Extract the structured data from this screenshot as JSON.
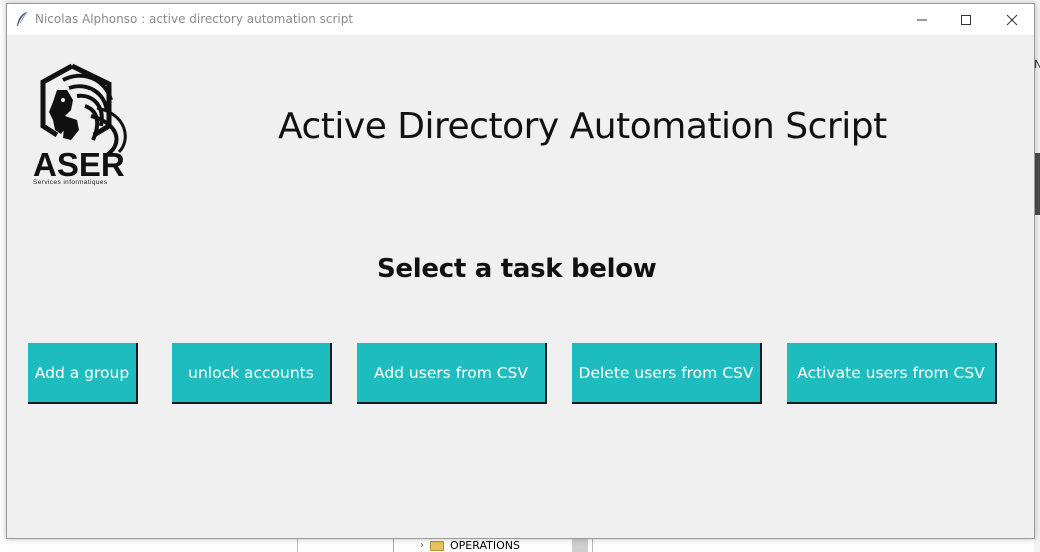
{
  "window": {
    "title": "Nicolas Alphonso : active directory automation script"
  },
  "logo": {
    "name": "ASER",
    "tagline": "Services informatiques"
  },
  "main": {
    "heading": "Active Directory Automation Script",
    "subheading": "Select a task below"
  },
  "buttons": [
    {
      "label": "Add a group"
    },
    {
      "label": "unlock accounts"
    },
    {
      "label": "Add users from CSV"
    },
    {
      "label": "Delete users from CSV"
    },
    {
      "label": "Activate users from CSV"
    }
  ],
  "background": {
    "explorer_item": "OPERATIONS",
    "right_edge_letter": "N"
  },
  "colors": {
    "button_bg": "#1fbcbf",
    "button_text": "#ffffff",
    "window_bg": "#f0f0f0",
    "title_text": "#8a8a8a"
  },
  "icons": {
    "app": "feather-icon",
    "minimize": "minimize-icon",
    "maximize": "maximize-icon",
    "close": "close-icon",
    "logo": "lion-hexagon-logo",
    "explorer_chevron": "chevron-right-icon",
    "explorer_folder": "folder-icon"
  }
}
